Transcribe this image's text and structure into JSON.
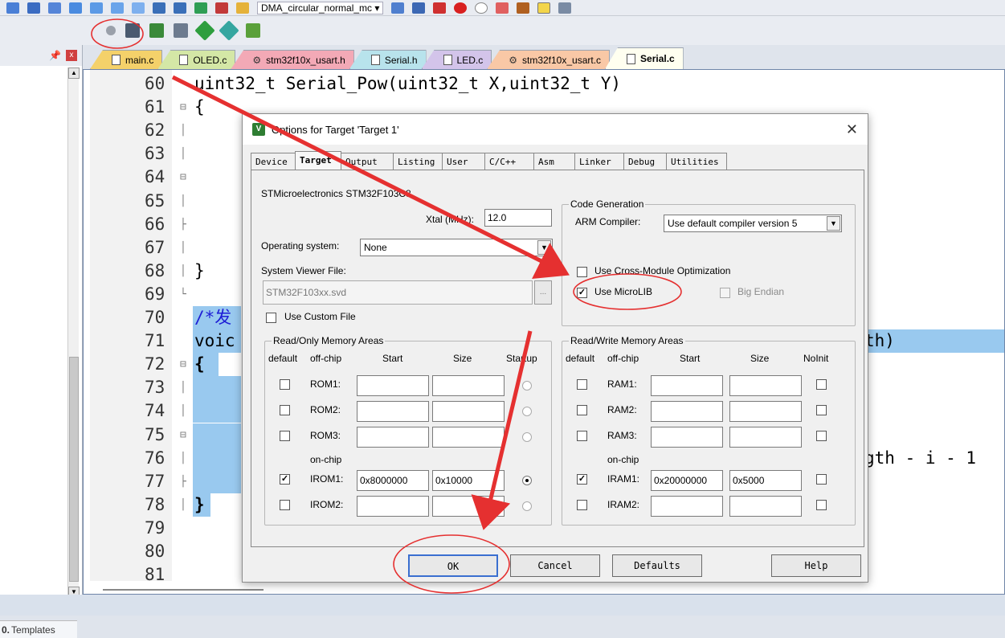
{
  "toolbar": {
    "target_select_value": "DMA_circular_normal_mc"
  },
  "left_panel": {
    "pin_glyph": "📌",
    "close_glyph": "x",
    "templates_label": "Templates",
    "templates_prefix": "0."
  },
  "file_tabs": [
    {
      "label": "main.c",
      "color": "#f4d16a",
      "kind": "file"
    },
    {
      "label": "OLED.c",
      "color": "#d4e7a6",
      "kind": "file"
    },
    {
      "label": "stm32f10x_usart.h",
      "color": "#f3a9b6",
      "kind": "gear"
    },
    {
      "label": "Serial.h",
      "color": "#b8e3ec",
      "kind": "file"
    },
    {
      "label": "LED.c",
      "color": "#d3c4ea",
      "kind": "file"
    },
    {
      "label": "stm32f10x_usart.c",
      "color": "#f9c8a6",
      "kind": "gear"
    },
    {
      "label": "Serial.c",
      "color": "#fffff0",
      "kind": "file"
    }
  ],
  "editor": {
    "lines": [
      {
        "num": "60",
        "fold": "",
        "code": "uint32_t Serial_Pow(uint32_t X,uint32_t Y)"
      },
      {
        "num": "61",
        "fold": "⊟",
        "code": "{"
      },
      {
        "num": "62",
        "fold": "│",
        "code": ""
      },
      {
        "num": "63",
        "fold": "│",
        "code": ""
      },
      {
        "num": "64",
        "fold": "⊟",
        "code": ""
      },
      {
        "num": "65",
        "fold": "│",
        "code": ""
      },
      {
        "num": "66",
        "fold": "├",
        "code": ""
      },
      {
        "num": "67",
        "fold": "│",
        "code": ""
      },
      {
        "num": "68",
        "fold": "│",
        "code": "}"
      },
      {
        "num": "69",
        "fold": "└",
        "code": ""
      },
      {
        "num": "70",
        "fold": "",
        "code": "/*发"
      },
      {
        "num": "71",
        "fold": "",
        "code": "voic"
      },
      {
        "num": "72",
        "fold": "⊟",
        "code": "{"
      },
      {
        "num": "73",
        "fold": "│",
        "code": ""
      },
      {
        "num": "74",
        "fold": "│",
        "code": ""
      },
      {
        "num": "75",
        "fold": "⊟",
        "code": ""
      },
      {
        "num": "76",
        "fold": "│",
        "code": ""
      },
      {
        "num": "77",
        "fold": "├",
        "code": ""
      },
      {
        "num": "78",
        "fold": "│",
        "code": "}"
      },
      {
        "num": "79",
        "fold": "",
        "code": ""
      },
      {
        "num": "80",
        "fold": "",
        "code": ""
      },
      {
        "num": "81",
        "fold": "",
        "code": ""
      }
    ],
    "right_fragment_71": "th)",
    "right_fragment_76": "gth - i - 1"
  },
  "dialog": {
    "title": "Options for Target 'Target 1'",
    "icon_letter": "V",
    "close_glyph": "✕",
    "tabs": [
      "Device",
      "Target",
      "Output",
      "Listing",
      "User",
      "C/C++",
      "Asm",
      "Linker",
      "Debug",
      "Utilities"
    ],
    "active_tab": "Target",
    "device_name": "STMicroelectronics STM32F103C8",
    "xtal_label": "Xtal (MHz):",
    "xtal_value": "12.0",
    "os_label": "Operating system:",
    "os_value": "None",
    "svf_label": "System Viewer File:",
    "svf_value": "STM32F103xx.svd",
    "browse_glyph": "...",
    "use_custom_file_label": "Use Custom File",
    "code_gen": {
      "title": "Code Generation",
      "arm_compiler_label": "ARM Compiler:",
      "arm_compiler_value": "Use default compiler version 5",
      "cross_module_label": "Use Cross-Module Optimization",
      "microlib_label": "Use MicroLIB",
      "microlib_checked": true,
      "big_endian_label": "Big Endian"
    },
    "ro_mem": {
      "title": "Read/Only Memory Areas",
      "headers": [
        "default",
        "off-chip",
        "Start",
        "Size",
        "Startup"
      ],
      "offchip": [
        {
          "name": "ROM1:",
          "start": "",
          "size": "",
          "checked": false
        },
        {
          "name": "ROM2:",
          "start": "",
          "size": "",
          "checked": false
        },
        {
          "name": "ROM3:",
          "start": "",
          "size": "",
          "checked": false
        }
      ],
      "onchip_label": "on-chip",
      "onchip": [
        {
          "name": "IROM1:",
          "start": "0x8000000",
          "size": "0x10000",
          "checked": true,
          "startup": true
        },
        {
          "name": "IROM2:",
          "start": "",
          "size": "",
          "checked": false,
          "startup": false
        }
      ]
    },
    "rw_mem": {
      "title": "Read/Write Memory Areas",
      "headers": [
        "default",
        "off-chip",
        "Start",
        "Size",
        "NoInit"
      ],
      "offchip": [
        {
          "name": "RAM1:",
          "start": "",
          "size": "",
          "checked": false
        },
        {
          "name": "RAM2:",
          "start": "",
          "size": "",
          "checked": false
        },
        {
          "name": "RAM3:",
          "start": "",
          "size": "",
          "checked": false
        }
      ],
      "onchip_label": "on-chip",
      "onchip": [
        {
          "name": "IRAM1:",
          "start": "0x20000000",
          "size": "0x5000",
          "checked": true
        },
        {
          "name": "IRAM2:",
          "start": "",
          "size": "",
          "checked": false
        }
      ]
    },
    "buttons": {
      "ok": "OK",
      "cancel": "Cancel",
      "defaults": "Defaults",
      "help": "Help"
    }
  },
  "colors": {
    "annotation_red": "#e53030",
    "selection_blue": "#99c9ef",
    "comment_blue": "#1d1dd6"
  }
}
